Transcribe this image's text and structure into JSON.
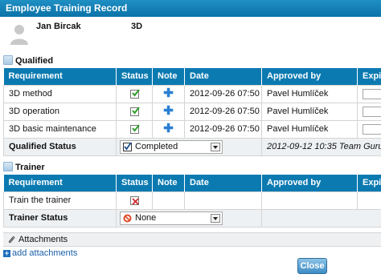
{
  "window": {
    "title": "Employee Training Record"
  },
  "user": {
    "name": "Jan Bircak",
    "code": "3D"
  },
  "qualified": {
    "section_title": "Qualified",
    "headers": [
      "Requirement",
      "Status",
      "Note",
      "Date",
      "Approved by",
      "Expira"
    ],
    "rows": [
      {
        "requirement": "3D method",
        "status": "checked",
        "note": "add-note",
        "date": "2012-09-26 07:50",
        "approved_by": "Pavel Humlíček"
      },
      {
        "requirement": "3D operation",
        "status": "checked",
        "note": "add-note",
        "date": "2012-09-26 07:50",
        "approved_by": "Pavel Humlíček"
      },
      {
        "requirement": "3D basic maintenance",
        "status": "checked",
        "note": "add-note",
        "date": "2012-09-26 07:50",
        "approved_by": "Pavel Humlíček"
      }
    ],
    "status_label": "Qualified Status",
    "status_value": "Completed",
    "status_info": "2012-09-12 10:35 Team Guru"
  },
  "trainer": {
    "section_title": "Trainer",
    "headers": [
      "Requirement",
      "Status",
      "Note",
      "Date",
      "Approved by",
      "Expira"
    ],
    "rows": [
      {
        "requirement": "Train the trainer",
        "status": "failed"
      }
    ],
    "status_label": "Trainer Status",
    "status_value": "None"
  },
  "attachments": {
    "label": "Attachments",
    "add_link": "add attachments"
  },
  "footer": {
    "close_label": "Close"
  },
  "colors": {
    "header_blue": "#0b7ab1",
    "check_green": "#2e9e2e",
    "fail_red": "#d22b2b"
  }
}
